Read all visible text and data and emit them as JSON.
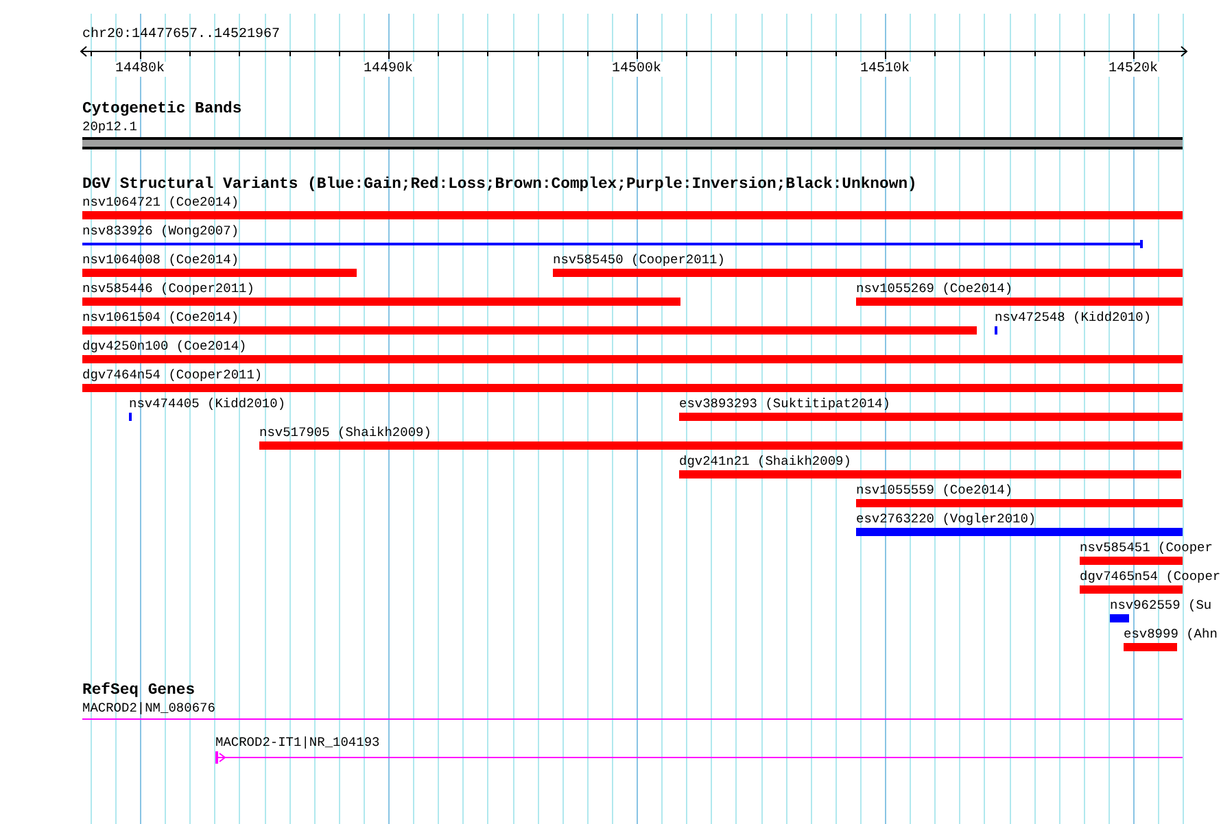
{
  "ruler": {
    "title": "chr20:14477657..14521967",
    "ticks": [
      {
        "label": "14480k"
      },
      {
        "label": "14490k"
      },
      {
        "label": "14500k"
      },
      {
        "label": "14510k"
      },
      {
        "label": "14520k"
      }
    ]
  },
  "tracks": [
    {
      "kind": "bands",
      "title": "Cytogenetic Bands",
      "rows": [
        [
          {
            "label": "20p12.1",
            "kind": "band",
            "color": "#a0a0a0"
          }
        ]
      ]
    },
    {
      "kind": "variants",
      "title": "DGV Structural Variants (Blue:Gain;Red:Loss;Brown:Complex;Purple:Inversion;Black:Unknown)",
      "rows": [
        [
          {
            "label": "nsv1064721 (Coe2014)",
            "kind": "bar",
            "color": "#ff0000"
          }
        ],
        [
          {
            "label": "nsv833926 (Wong2007)",
            "kind": "line",
            "color": "#0000ff"
          }
        ],
        [
          {
            "label": "nsv1064008 (Coe2014)",
            "kind": "bar",
            "color": "#ff0000"
          },
          {
            "label": "nsv585450 (Cooper2011)",
            "kind": "bar",
            "color": "#ff0000"
          }
        ],
        [
          {
            "label": "nsv585446 (Cooper2011)",
            "kind": "bar",
            "color": "#ff0000"
          },
          {
            "label": "nsv1055269 (Coe2014)",
            "kind": "bar",
            "color": "#ff0000"
          }
        ],
        [
          {
            "label": "nsv1061504 (Coe2014)",
            "kind": "bar",
            "color": "#ff0000"
          },
          {
            "label": "nsv472548 (Kidd2010)",
            "kind": "bar",
            "color": "#0000ff"
          }
        ],
        [
          {
            "label": "dgv4250n100 (Coe2014)",
            "kind": "bar",
            "color": "#ff0000"
          }
        ],
        [
          {
            "label": "dgv7464n54 (Cooper2011)",
            "kind": "bar",
            "color": "#ff0000"
          }
        ],
        [
          {
            "label": "nsv474405 (Kidd2010)",
            "kind": "bar",
            "color": "#0000ff"
          },
          {
            "label": "esv3893293 (Suktitipat2014)",
            "kind": "bar",
            "color": "#ff0000"
          }
        ],
        [
          {
            "label": "nsv517905 (Shaikh2009)",
            "kind": "bar",
            "color": "#ff0000"
          }
        ],
        [
          {
            "label": "dgv241n21 (Shaikh2009)",
            "kind": "bar",
            "color": "#ff0000"
          }
        ],
        [
          {
            "label": "nsv1055559 (Coe2014)",
            "kind": "bar",
            "color": "#ff0000"
          }
        ],
        [
          {
            "label": "esv2763220 (Vogler2010)",
            "kind": "bar",
            "color": "#0000ff"
          }
        ],
        [
          {
            "label": "nsv585451 (Cooper",
            "kind": "bar",
            "color": "#ff0000"
          }
        ],
        [
          {
            "label": "dgv7465n54 (Cooper",
            "kind": "bar",
            "color": "#ff0000"
          }
        ],
        [
          {
            "label": "nsv962559 (Su",
            "kind": "bar",
            "color": "#0000ff"
          }
        ],
        [
          {
            "label": "esv8999 (Ahn",
            "kind": "bar",
            "color": "#ff0000"
          }
        ]
      ]
    },
    {
      "kind": "genes",
      "title": "RefSeq Genes",
      "rows": [
        [
          {
            "label": "MACROD2|NM_080676",
            "kind": "gene",
            "color": "#ff00ff"
          }
        ],
        [
          {
            "label": "MACROD2-IT1|NR_104193",
            "kind": "gene_start",
            "color": "#ff00ff"
          }
        ]
      ]
    }
  ]
}
